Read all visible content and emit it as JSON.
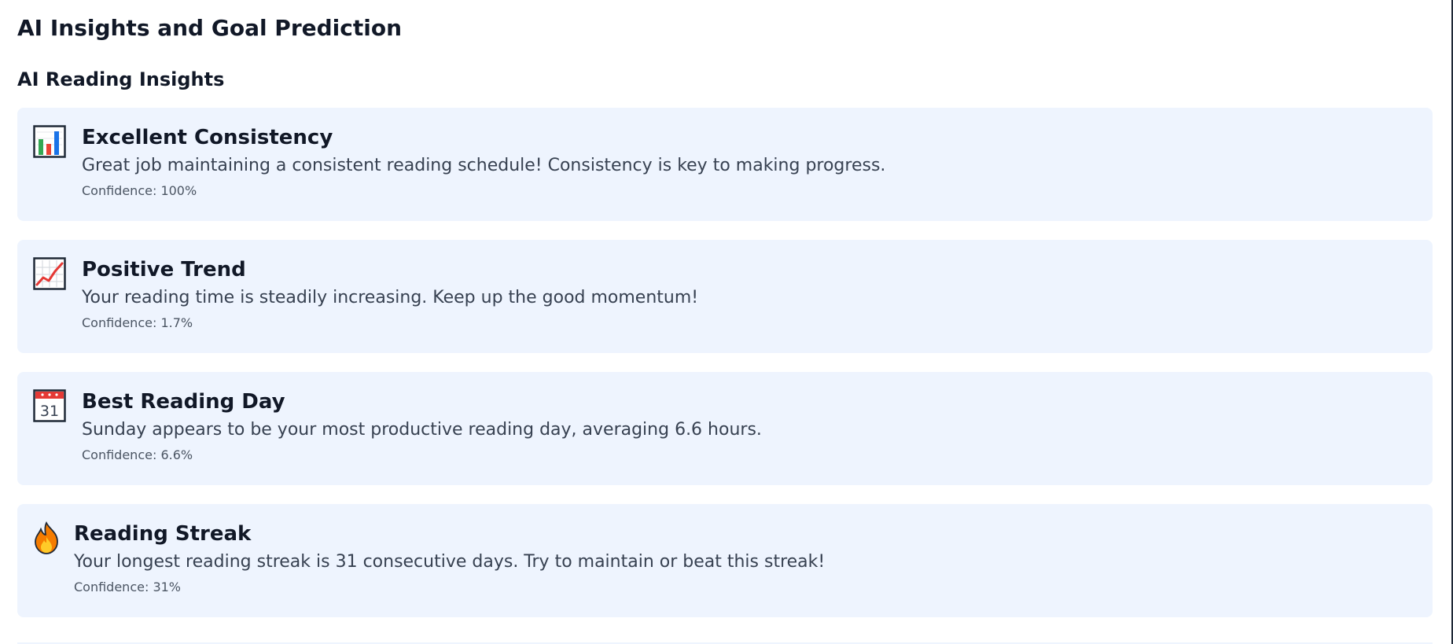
{
  "page": {
    "title": "AI Insights and Goal Prediction"
  },
  "insights_section": {
    "title": "AI Reading Insights",
    "items": [
      {
        "icon": "bar-chart-icon",
        "title": "Excellent Consistency",
        "description": "Great job maintaining a consistent reading schedule! Consistency is key to making progress.",
        "confidence": "Confidence: 100%"
      },
      {
        "icon": "trend-up-chart-icon",
        "title": "Positive Trend",
        "description": "Your reading time is steadily increasing. Keep up the good momentum!",
        "confidence": "Confidence: 1.7%"
      },
      {
        "icon": "calendar-icon",
        "title": "Best Reading Day",
        "description": "Sunday appears to be your most productive reading day, averaging 6.6 hours.",
        "confidence": "Confidence: 6.6%"
      },
      {
        "icon": "fire-icon",
        "title": "Reading Streak",
        "description": "Your longest reading streak is 31 consecutive days. Try to maintain or beat this streak!",
        "confidence": "Confidence: 31%"
      }
    ]
  },
  "colors": {
    "card_background": "#eef4fe",
    "title_text": "#111827",
    "body_text": "#374151",
    "muted_text": "#4b5563"
  },
  "calendar_icon_day": "31"
}
